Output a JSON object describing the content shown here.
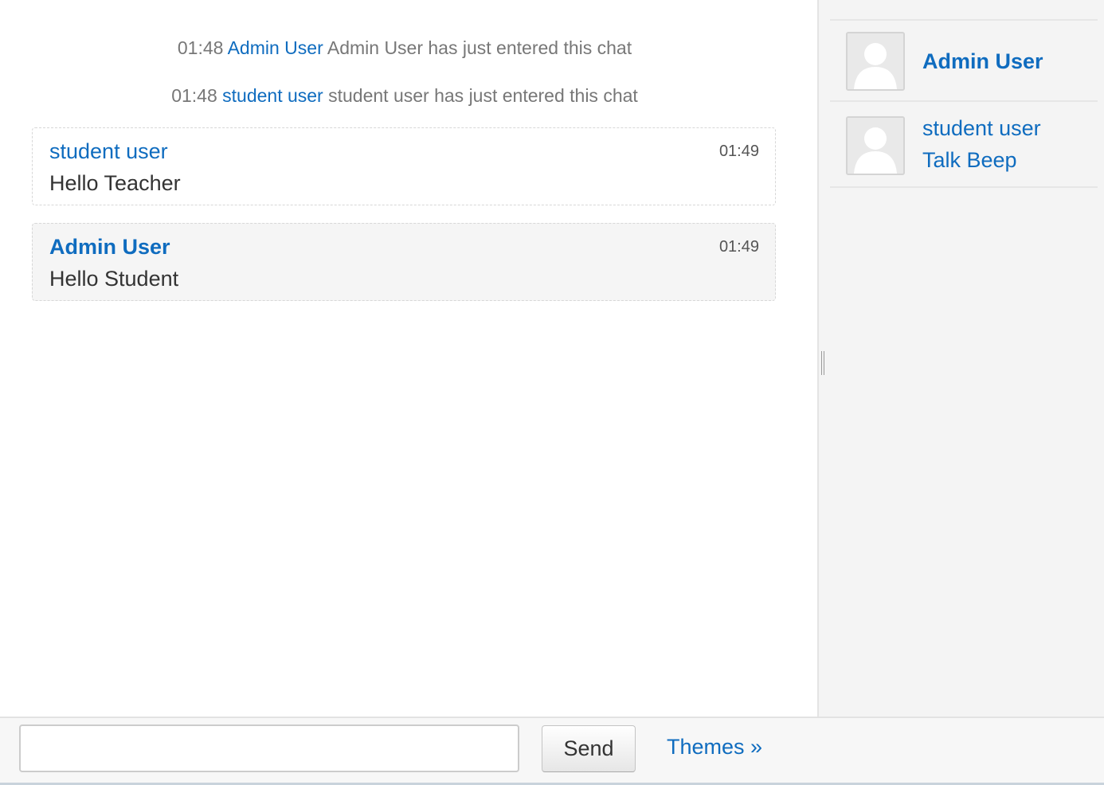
{
  "system_messages": [
    {
      "time": "01:48",
      "user": "Admin User",
      "text": "Admin User has just entered this chat"
    },
    {
      "time": "01:48",
      "user": "student user",
      "text": "student user has just entered this chat"
    }
  ],
  "messages": [
    {
      "user": "student user",
      "time": "01:49",
      "text": "Hello Teacher"
    },
    {
      "user": "Admin User",
      "time": "01:49",
      "text": "Hello Student"
    }
  ],
  "users": [
    {
      "name": "Admin User",
      "avatar_icon": "user-avatar-icon"
    },
    {
      "name": "student user",
      "action": "Talk Beep",
      "avatar_icon": "user-avatar-icon"
    }
  ],
  "input": {
    "value": "",
    "placeholder": ""
  },
  "buttons": {
    "send": "Send",
    "themes": "Themes »"
  },
  "colors": {
    "link": "#0f6cbf",
    "panel_bg": "#f4f4f4",
    "system_text": "#777777"
  }
}
